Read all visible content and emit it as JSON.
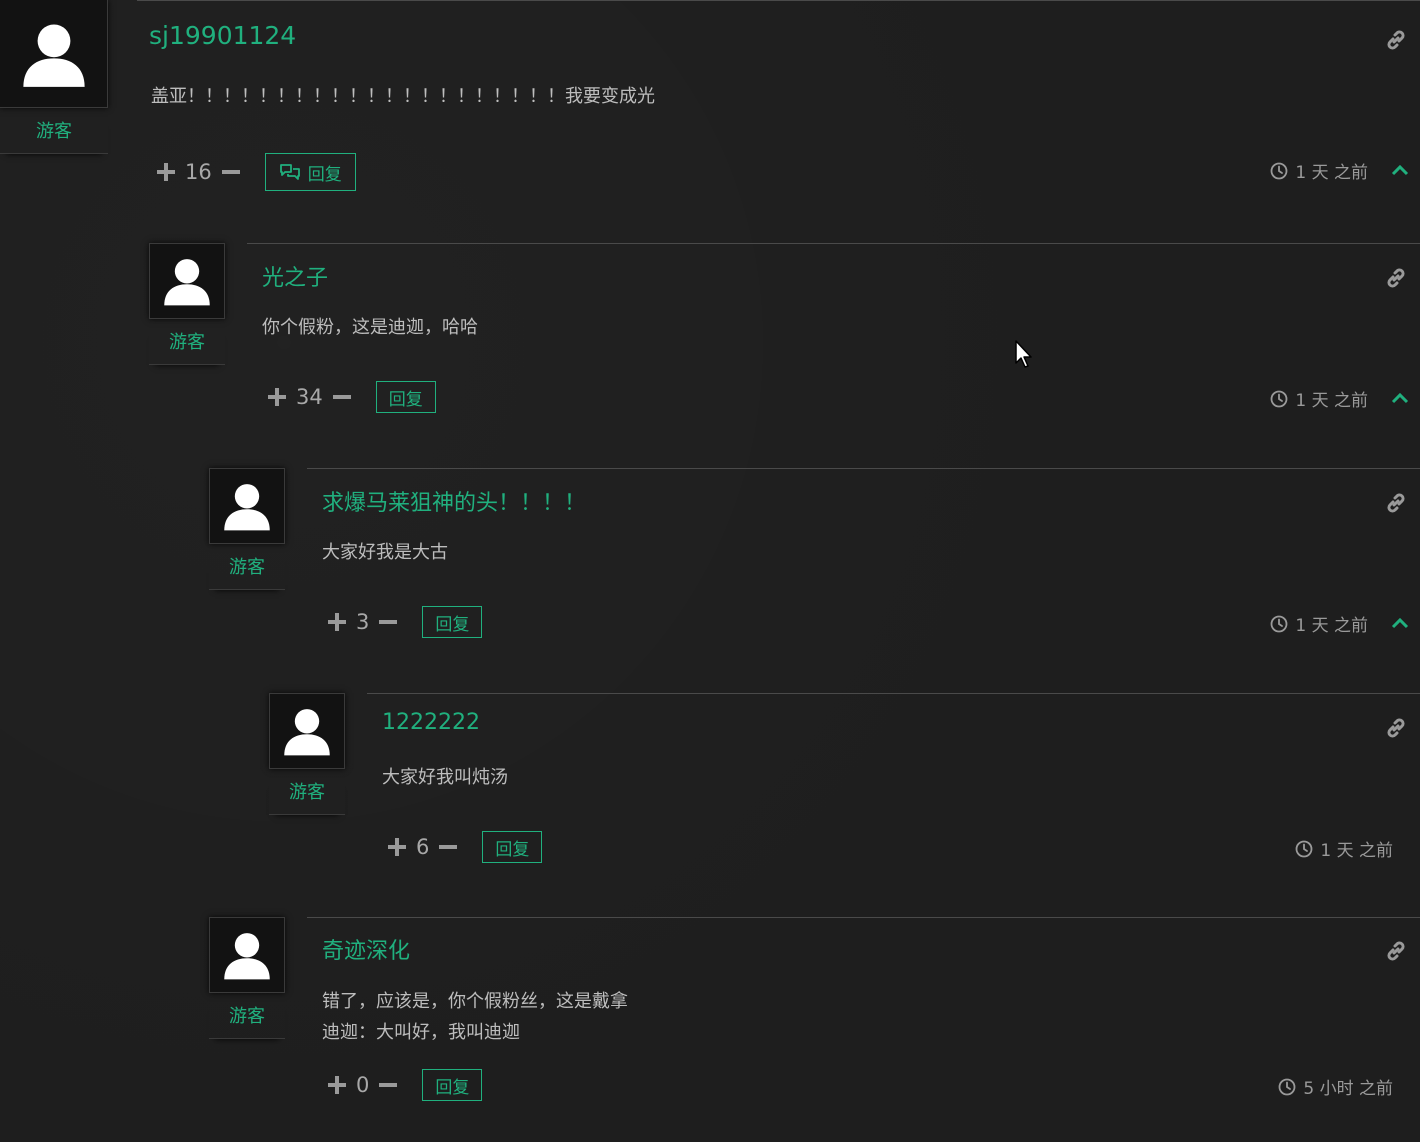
{
  "role_label": "游客",
  "reply_label": "回复",
  "colors": {
    "accent": "#20b07e",
    "background": "#1e1e1e",
    "text": "#bdbdbd",
    "muted": "#9a9a9a"
  },
  "icons": {
    "avatar": "user-silhouette-icon",
    "link": "link-icon",
    "clock": "clock-icon",
    "collapse": "chevron-up-icon",
    "reply": "chat-bubbles-icon",
    "cursor": "mouse-pointer-icon"
  },
  "comments": [
    {
      "author": "sj19901124",
      "role": "游客",
      "content": "盖亚！！！！！！！！！！！！！！！！！！！！！我要变成光",
      "score": "16",
      "time": "1 天 之前"
    },
    {
      "author": "光之子",
      "role": "游客",
      "content": "你个假粉，这是迪迦，哈哈",
      "score": "34",
      "time": "1 天 之前"
    },
    {
      "author": "求爆马莱狙神的头！！！！",
      "role": "游客",
      "content": "大家好我是大古",
      "score": "3",
      "time": "1 天 之前"
    },
    {
      "author": "1222222",
      "role": "游客",
      "content": "大家好我叫炖汤",
      "score": "6",
      "time": "1 天 之前"
    },
    {
      "author": "奇迹深化",
      "role": "游客",
      "content": "错了，应该是，你个假粉丝，这是戴拿\n迪迦：大叫好，我叫迪迦",
      "score": "0",
      "time": "5 小时 之前"
    }
  ]
}
